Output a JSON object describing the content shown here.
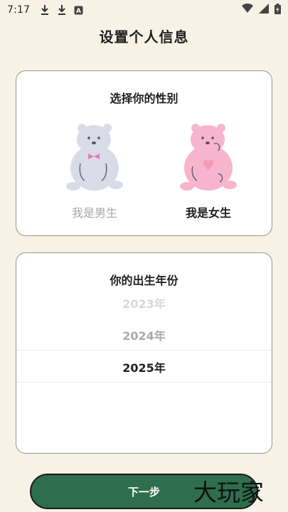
{
  "status_bar": {
    "time": "7:17",
    "left_icons": [
      "download-icon",
      "download-icon",
      "keyboard-a-icon"
    ],
    "right_icons": [
      "wifi-icon",
      "signal-icon",
      "battery-icon"
    ]
  },
  "header": {
    "title": "设置个人信息"
  },
  "gender_card": {
    "title": "选择你的性别",
    "options": [
      {
        "label": "我是男生",
        "selected": false,
        "bear_color": "#d9dce8",
        "bow_color": "#e27bb0"
      },
      {
        "label": "我是女生",
        "selected": true,
        "bear_color": "#f7b5cd",
        "heart_color": "#f39bb9"
      }
    ]
  },
  "year_card": {
    "title": "你的出生年份",
    "years": [
      "2023年",
      "2024年",
      "2025年"
    ],
    "selected_year": "2025年"
  },
  "footer": {
    "next_label": "下一步"
  },
  "watermark": {
    "text": "大玩家"
  },
  "colors": {
    "background": "#f6f3e6",
    "card_border": "#8f9a80",
    "primary_button": "#2f6e4c"
  }
}
